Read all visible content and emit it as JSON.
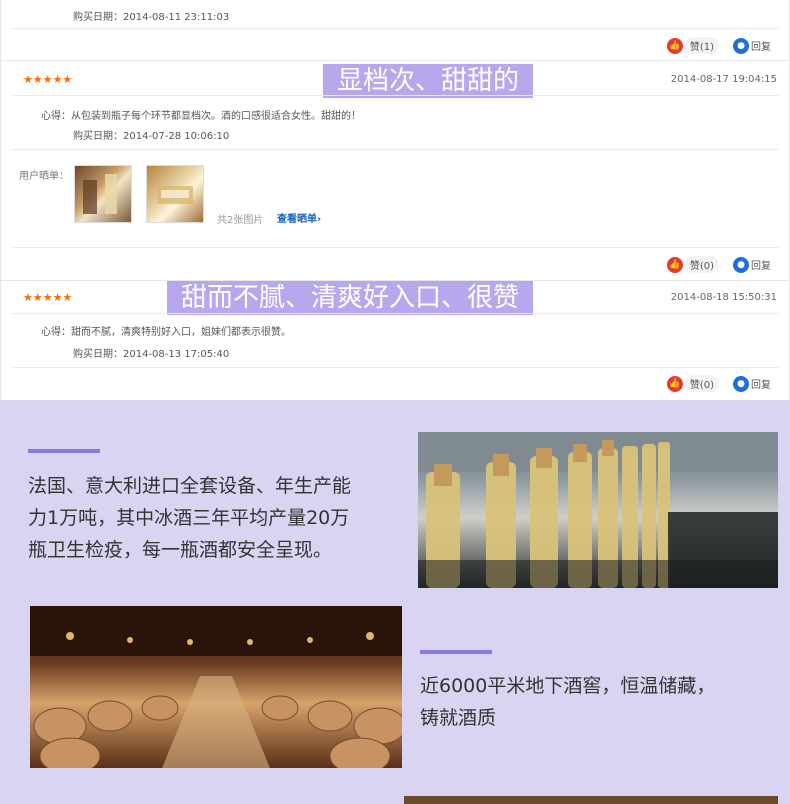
{
  "reviews": [
    {
      "purchase_label": "购买日期：",
      "purchase_date": "2014-08-11 23:11:03",
      "like_label": "赞",
      "like_count": "(1)",
      "reply_label": "回复"
    },
    {
      "stars": "★★★★★",
      "highlight": "显档次、甜甜的",
      "date": "2014-08-17 19:04:15",
      "comment_label": "心得：",
      "comment": "从包装到瓶子每个环节都显档次。酒的口感很适合女性。甜甜的！",
      "purchase_label": "购买日期：",
      "purchase_date": "2014-07-28 10:06:10",
      "show_label": "用户晒单：",
      "pics_count": "共2张图片",
      "view_link": "查看晒单",
      "view_arrow": "›",
      "like_label": "赞",
      "like_count": "(0)",
      "reply_label": "回复"
    },
    {
      "stars": "★★★★★",
      "highlight": "甜而不腻、清爽好入口、很赞",
      "date": "2014-08-18 15:50:31",
      "comment_label": "心得：",
      "comment": "甜而不腻，清爽特别好入口，姐妹们都表示很赞。",
      "purchase_label": "购买日期：",
      "purchase_date": "2014-08-13 17:05:40",
      "like_label": "赞",
      "like_count": "(0)",
      "reply_label": "回复"
    }
  ],
  "promo": {
    "block1_line1": "法国、意大利进口全套设备、年生产能",
    "block1_line2": "力1万吨，其中冰酒三年平均产量20万",
    "block1_line3": "瓶卫生检疫，每一瓶酒都安全呈现。",
    "block2_line1": "近6000平米地下酒窖，恒温储藏，",
    "block2_line2": "铸就酒质"
  },
  "colors": {
    "accent": "#8e7ae0",
    "promo_bg": "#d9d4f2",
    "highlight_bg": "#b9a7ee",
    "star": "#ff6a00",
    "like": "#e53935",
    "reply": "#1e6fd9"
  }
}
